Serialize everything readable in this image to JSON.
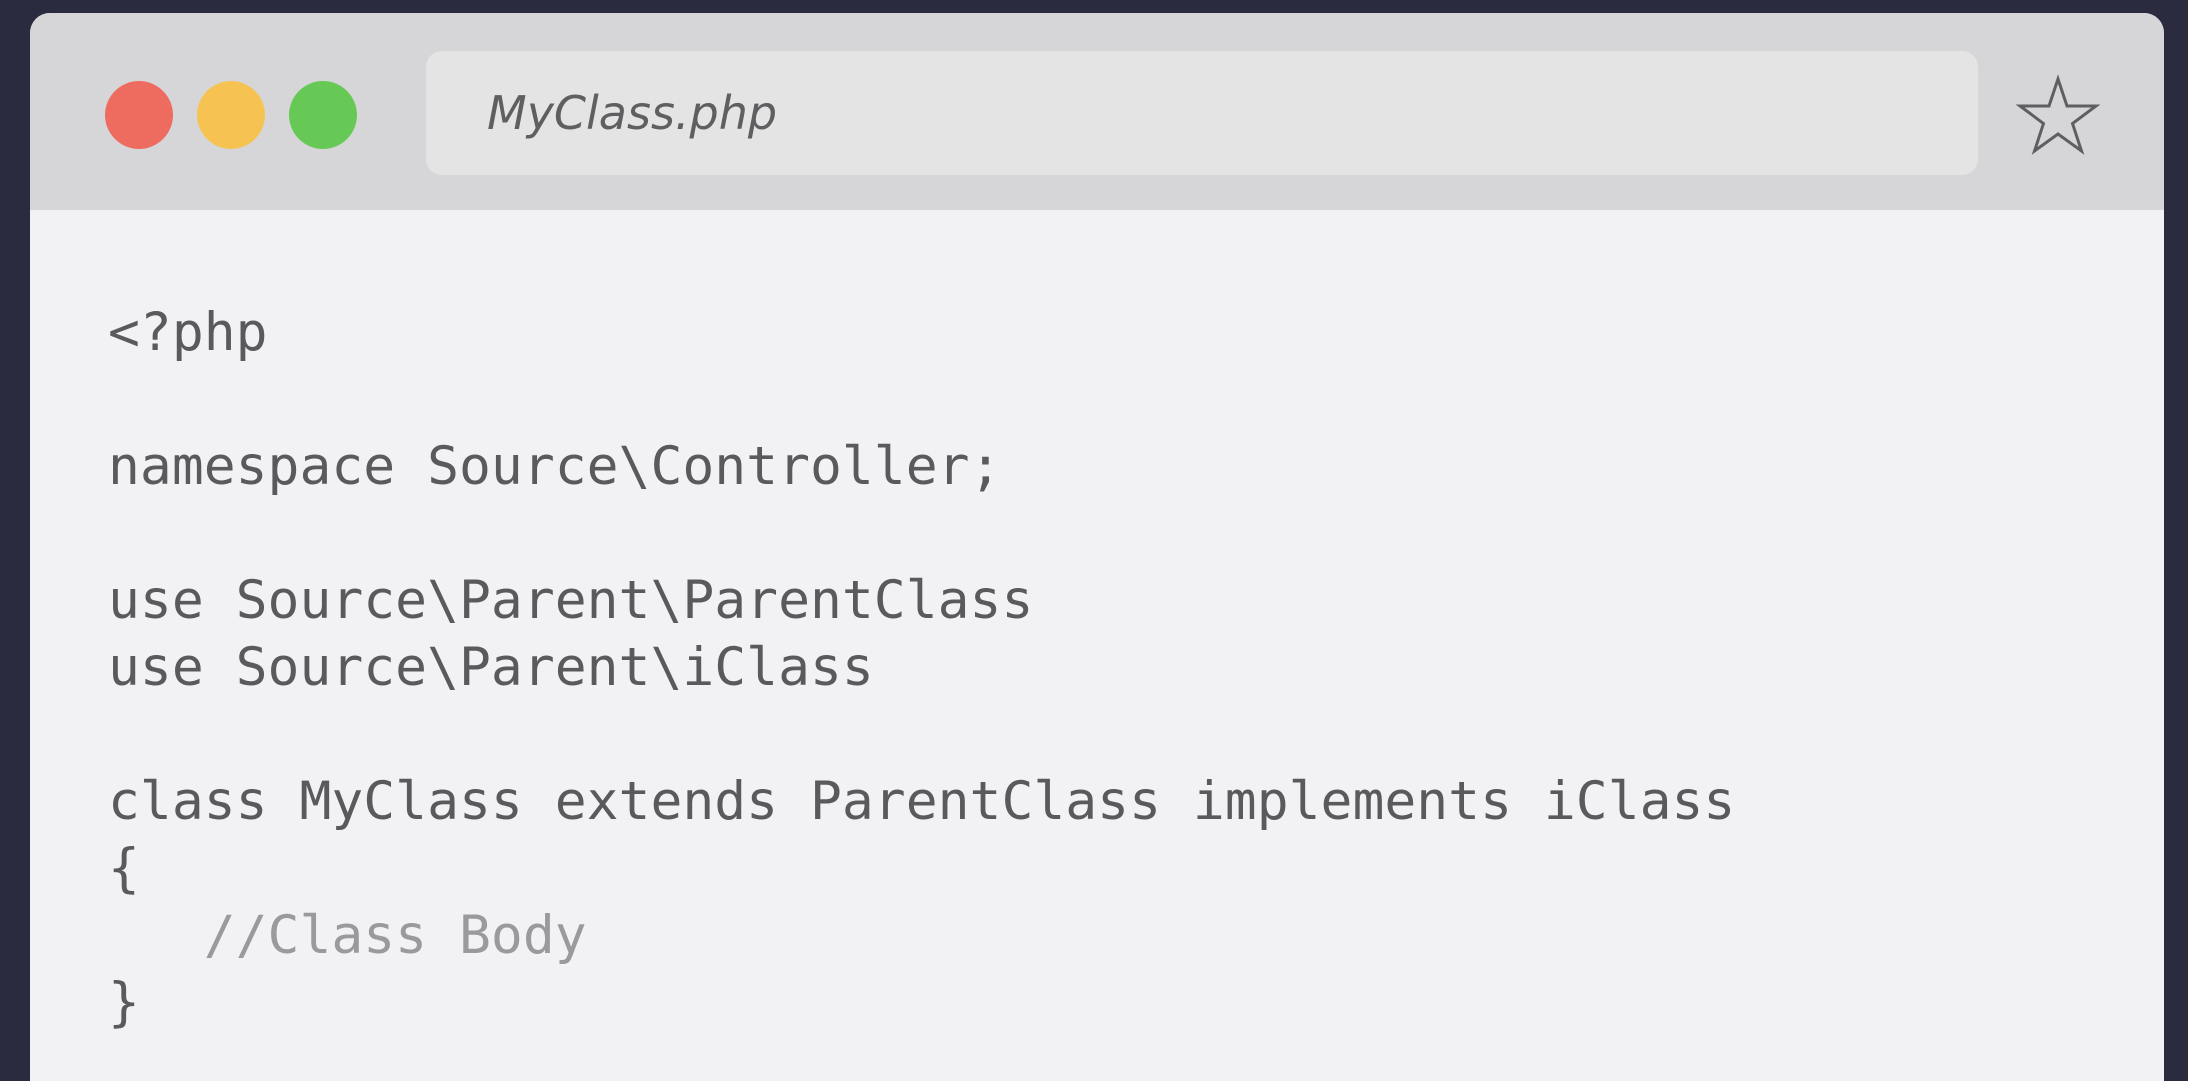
{
  "window": {
    "tab_title": "MyClass.php",
    "traffic_lights": {
      "close": "#ee6b60",
      "minimize": "#f6c353",
      "maximize": "#66c955"
    },
    "star_icon": "star-outline-icon"
  },
  "editor": {
    "language": "php",
    "lines": [
      {
        "text": "<?php",
        "kind": "code"
      },
      {
        "text": "",
        "kind": "blank"
      },
      {
        "text": "namespace Source\\Controller;",
        "kind": "code"
      },
      {
        "text": "",
        "kind": "blank"
      },
      {
        "text": "use Source\\Parent\\ParentClass",
        "kind": "code"
      },
      {
        "text": "use Source\\Parent\\iClass",
        "kind": "code"
      },
      {
        "text": "",
        "kind": "blank"
      },
      {
        "text": "class MyClass extends ParentClass implements iClass",
        "kind": "code"
      },
      {
        "text": "{",
        "kind": "code"
      },
      {
        "text": "   //Class Body",
        "kind": "comment"
      },
      {
        "text": "}",
        "kind": "code"
      }
    ]
  },
  "colors": {
    "page_background": "#2b2b40",
    "titlebar": "#d6d6d8",
    "tabbar": "#e4e4e5",
    "editor_background": "#f2f2f4",
    "code_text": "#5a5a5e",
    "comment_text": "#9a9a9d"
  }
}
